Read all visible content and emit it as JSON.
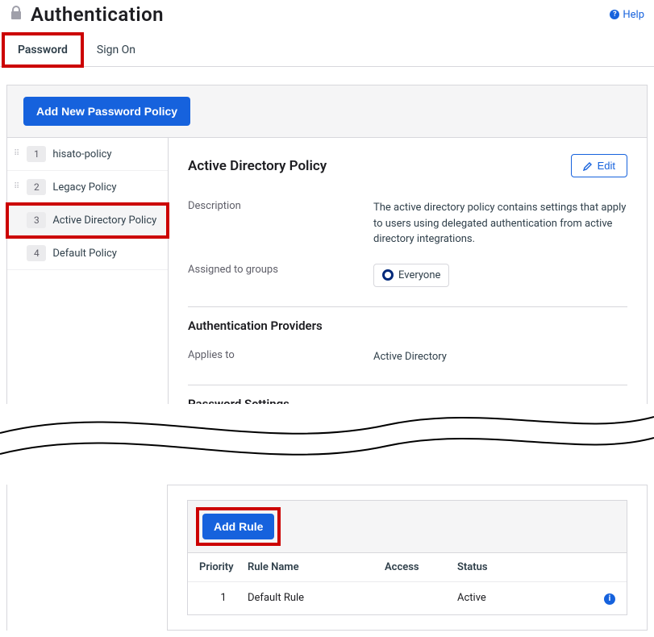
{
  "header": {
    "title": "Authentication",
    "help_label": "Help"
  },
  "tabs": {
    "password": "Password",
    "sign_on": "Sign On"
  },
  "add_policy_button": "Add New Password Policy",
  "sidebar_policies": [
    {
      "num": "1",
      "name": "hisato-policy"
    },
    {
      "num": "2",
      "name": "Legacy Policy"
    },
    {
      "num": "3",
      "name": "Active Directory Policy"
    },
    {
      "num": "4",
      "name": "Default Policy"
    }
  ],
  "detail": {
    "title": "Active Directory Policy",
    "edit_label": "Edit",
    "description_label": "Description",
    "description_value": "The active directory policy contains settings that apply to users using delegated authentication from active directory integrations.",
    "assigned_label": "Assigned to groups",
    "assigned_group": "Everyone",
    "auth_providers_title": "Authentication Providers",
    "applies_to_label": "Applies to",
    "applies_to_value": "Active Directory",
    "password_settings_title": "Password Settings"
  },
  "rules": {
    "add_rule_label": "Add Rule",
    "columns": {
      "priority": "Priority",
      "rule_name": "Rule Name",
      "access": "Access",
      "status": "Status"
    },
    "rows": [
      {
        "priority": "1",
        "rule_name": "Default Rule",
        "access": "",
        "status": "Active"
      }
    ]
  }
}
